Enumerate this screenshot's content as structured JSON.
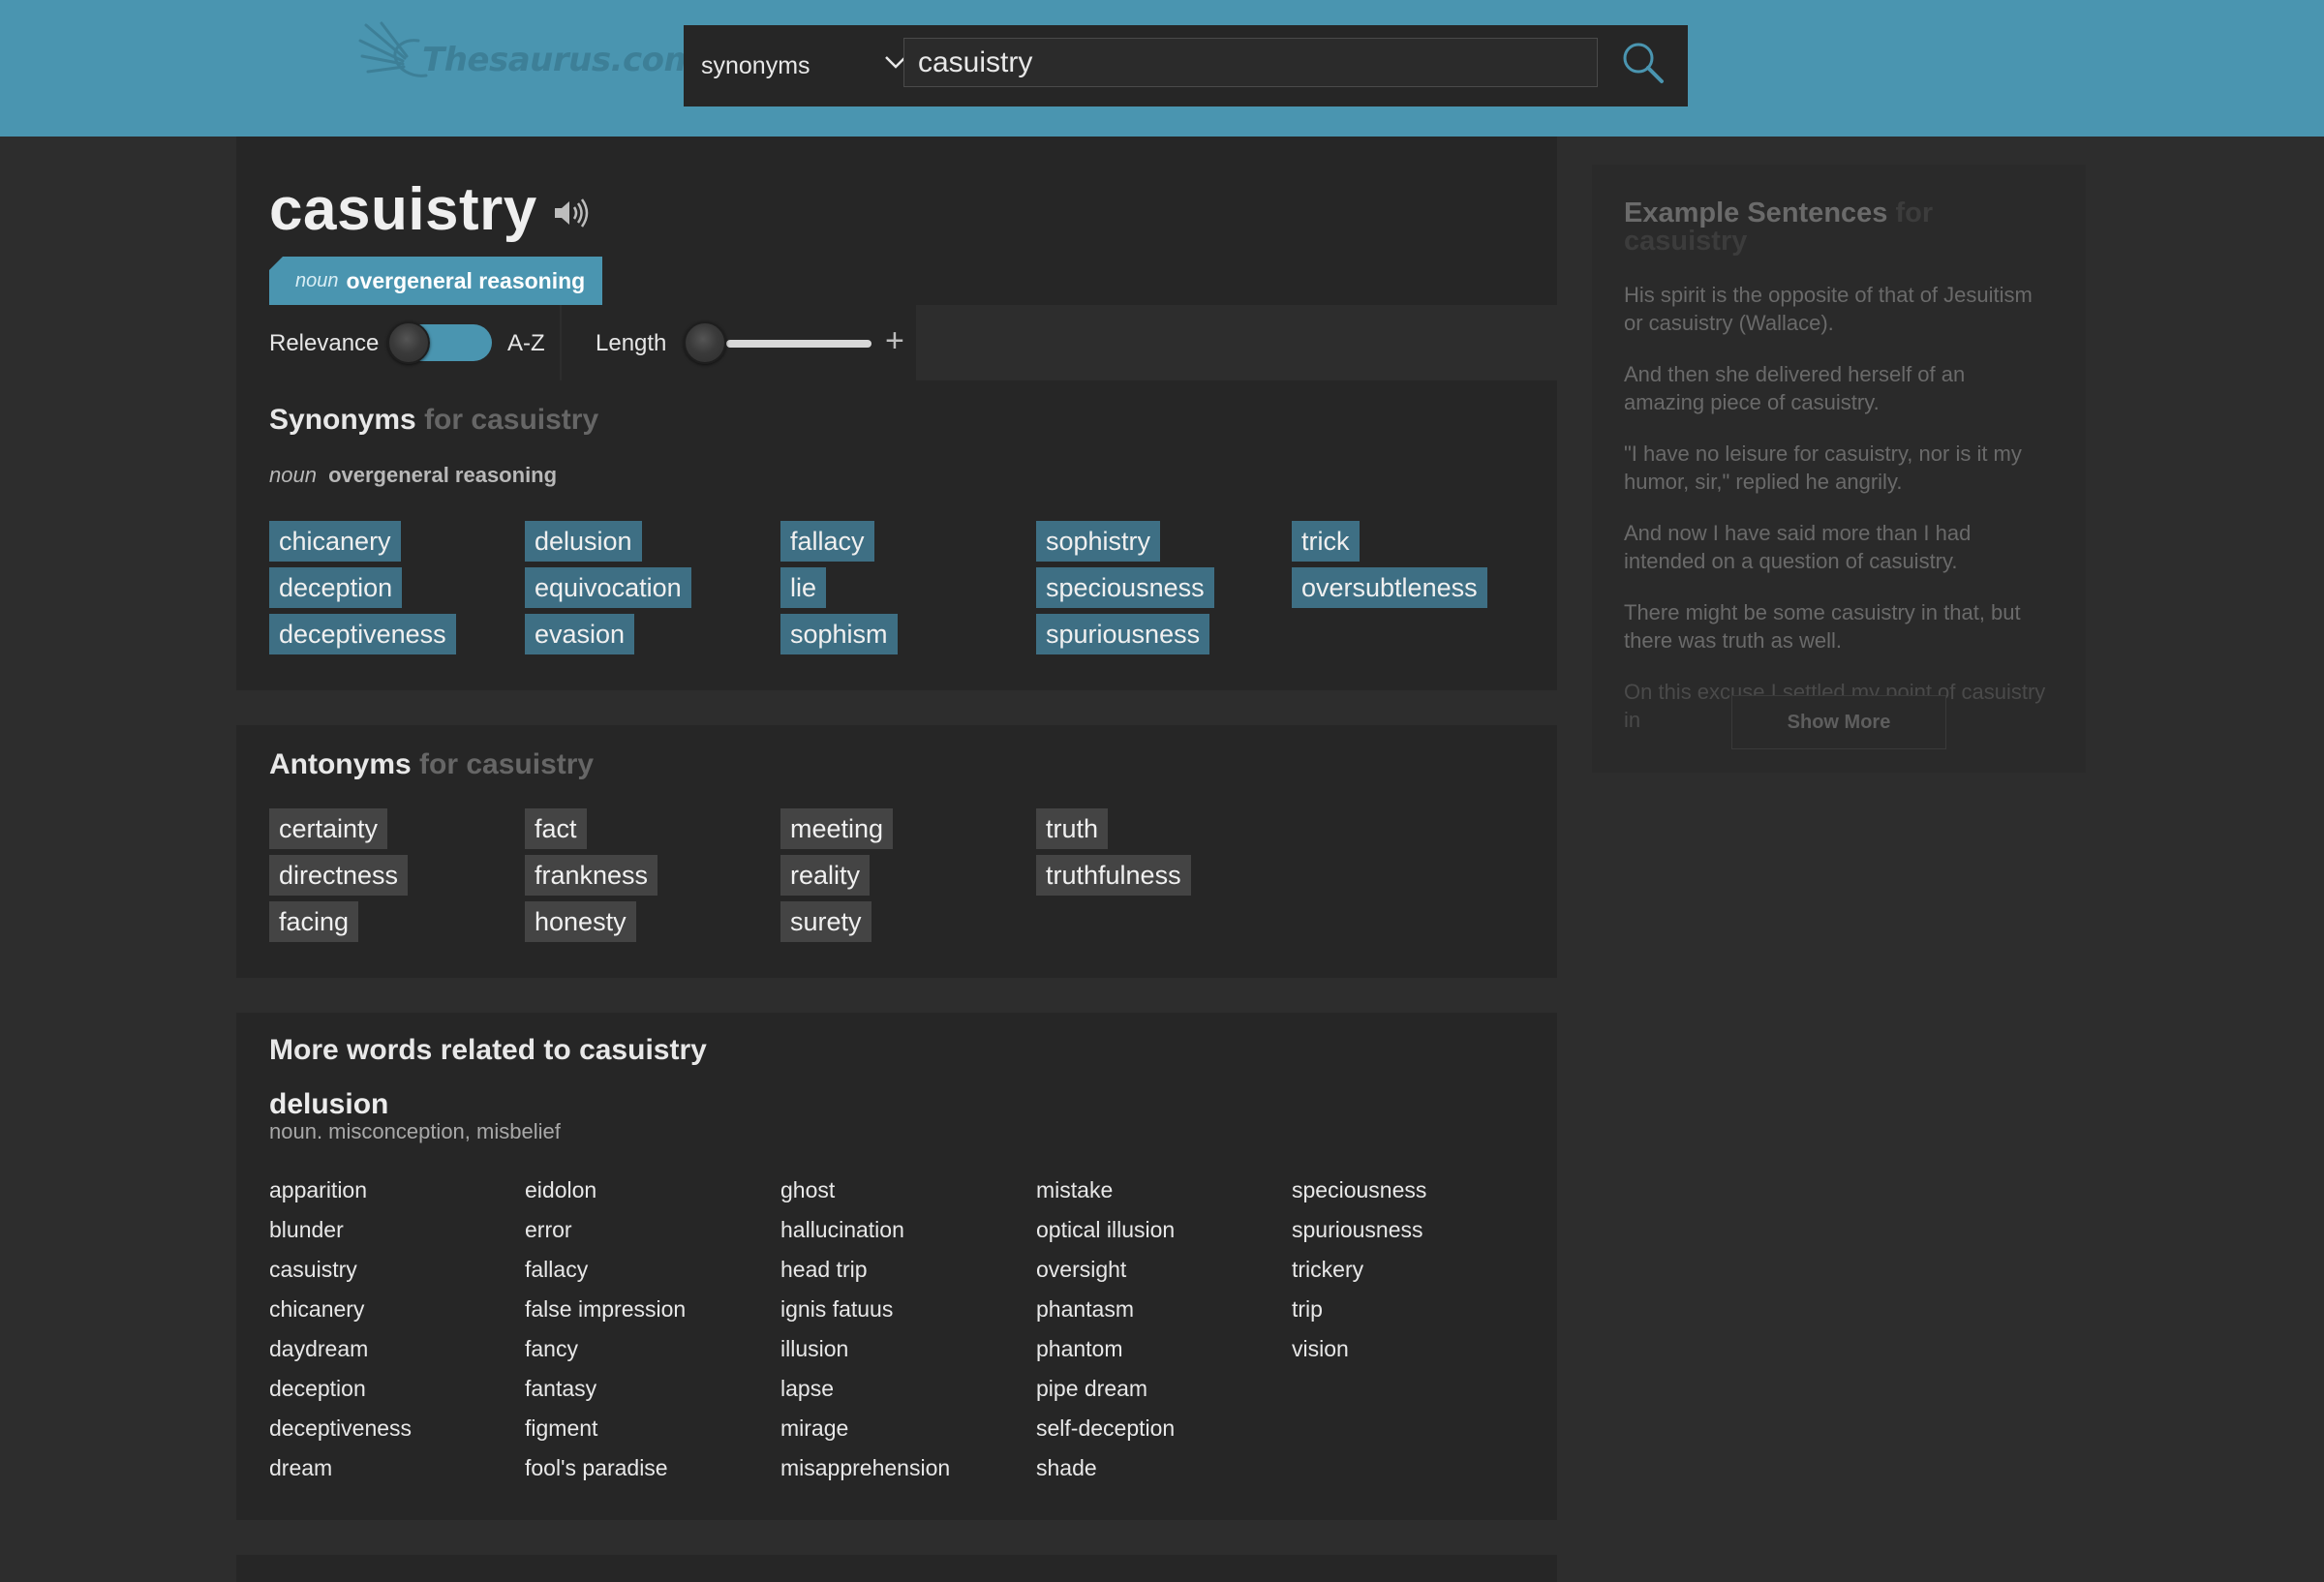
{
  "header": {
    "logo_text": "Thesaurus.com",
    "search_type": "synonyms",
    "search_value": "casuistry"
  },
  "entry": {
    "word": "casuistry",
    "sense_pos": "noun",
    "sense_def": "overgeneral reasoning"
  },
  "controls": {
    "relevance_label": "Relevance",
    "az_label": "A-Z",
    "length_label": "Length"
  },
  "synonyms": {
    "title": "Synonyms",
    "for_text": "for casuistry",
    "pos": "noun",
    "definition": "overgeneral reasoning",
    "words": [
      "chicanery",
      "deception",
      "deceptiveness",
      "delusion",
      "equivocation",
      "evasion",
      "fallacy",
      "lie",
      "sophism",
      "sophistry",
      "speciousness",
      "spuriousness",
      "trick",
      "oversubtleness"
    ]
  },
  "antonyms": {
    "title": "Antonyms",
    "for_text": "for casuistry",
    "words": [
      "certainty",
      "directness",
      "facing",
      "fact",
      "frankness",
      "honesty",
      "meeting",
      "reality",
      "surety",
      "truth",
      "truthfulness"
    ]
  },
  "more_words": {
    "title_prefix": "More words related to",
    "title_word": "casuistry",
    "word": "delusion",
    "definition": "noun. misconception, misbelief",
    "items": [
      "apparition",
      "blunder",
      "casuistry",
      "chicanery",
      "daydream",
      "deception",
      "deceptiveness",
      "dream",
      "eidolon",
      "error",
      "fallacy",
      "false impression",
      "fancy",
      "fantasy",
      "figment",
      "fool's paradise",
      "ghost",
      "hallucination",
      "head trip",
      "ignis fatuus",
      "illusion",
      "lapse",
      "mirage",
      "misapprehension",
      "mistake",
      "optical illusion",
      "oversight",
      "phantasm",
      "phantom",
      "pipe dream",
      "self-deception",
      "shade",
      "speciousness",
      "spuriousness",
      "trickery",
      "trip",
      "vision"
    ]
  },
  "examples": {
    "title": "Example Sentences",
    "for_text": "for casuistry",
    "sentences": [
      "His spirit is the opposite of that of Jesuitism or casuistry (Wallace).",
      "And then she delivered herself of an amazing piece of casuistry.",
      "\"I have no leisure for casuistry, nor is it my humor, sir,\" replied he angrily.",
      "And now I have said more than I had intended on a question of casuistry.",
      "There might be some casuistry in that, but there was truth as well.",
      "On this excuse I settled my point of casuistry in"
    ],
    "show_more": "Show More"
  },
  "colors": {
    "header_bg": "#4a95b0",
    "synonym_chip": "#3e6f84",
    "antonym_chip": "#444444",
    "panel_bg": "#262626",
    "page_bg": "#2d2d2d"
  }
}
